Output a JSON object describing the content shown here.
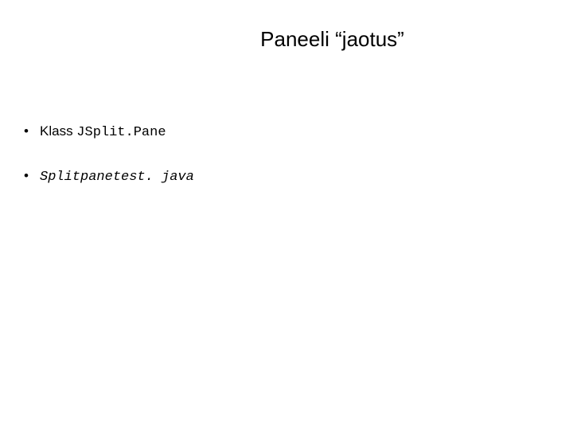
{
  "slide": {
    "title": "Paneeli “jaotus”",
    "bullets": [
      {
        "prefix": "Klass ",
        "code": "JSplit.Pane"
      },
      {
        "file": "Splitpanetest. java"
      }
    ]
  }
}
